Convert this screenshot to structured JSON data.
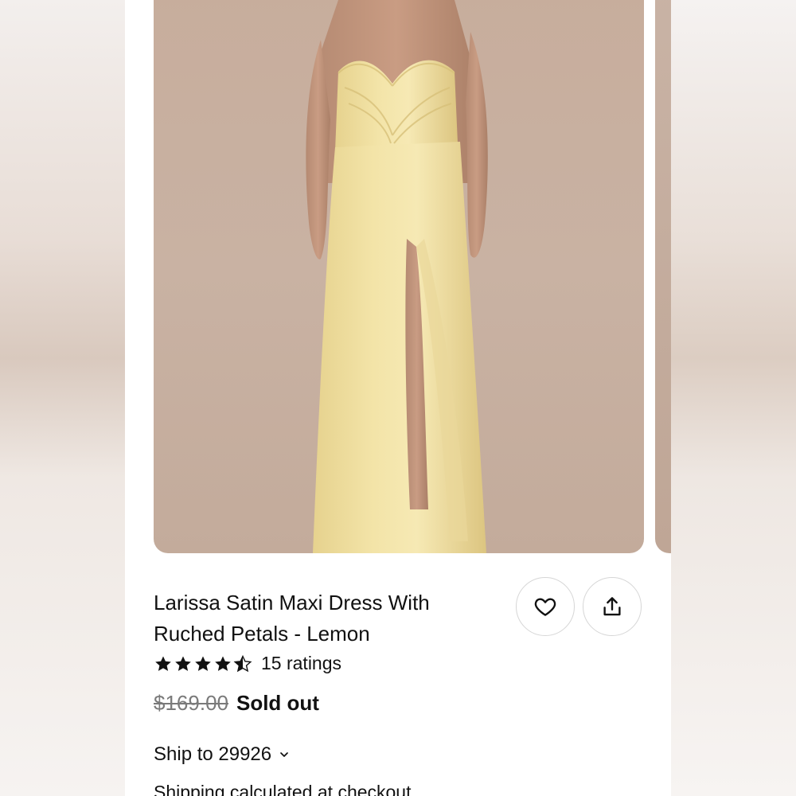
{
  "product": {
    "title": "Larissa Satin Maxi Dress With Ruched Petals - Lemon",
    "rating": {
      "stars": 4.5,
      "count_label": "15 ratings"
    },
    "price": {
      "original": "$169.00",
      "status": "Sold out"
    },
    "shipping": {
      "ship_to_label": "Ship to 29926",
      "note": "Shipping calculated at checkout"
    }
  },
  "icons": {
    "favorite": "heart-icon",
    "share": "share-icon",
    "shipping_dropdown": "chevron-down-icon",
    "star": "star-icon"
  },
  "colors": {
    "photo_background": "#c7ad9c",
    "dress": "#f0e0a2",
    "text": "#111111",
    "muted_price": "#7a7a7a"
  }
}
